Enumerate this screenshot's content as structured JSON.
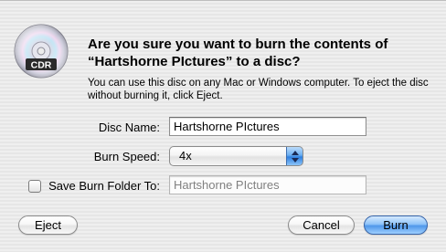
{
  "dialog": {
    "icon": "cdr-disc-icon",
    "icon_label": "CDR",
    "heading": "Are you sure you want to burn the contents of “Hartshorne PIctures” to a disc?",
    "message": "You can use this disc on any Mac or Windows computer. To eject the disc without burning it, click Eject."
  },
  "form": {
    "disc_name_label": "Disc Name:",
    "disc_name_value": "Hartshorne PIctures",
    "burn_speed_label": "Burn Speed:",
    "burn_speed_value": "4x",
    "save_folder_label": "Save Burn Folder To:",
    "save_folder_value": "Hartshorne PIctures",
    "save_folder_checked": false
  },
  "buttons": {
    "eject": "Eject",
    "cancel": "Cancel",
    "burn": "Burn"
  },
  "colors": {
    "accent": "#4e97ea",
    "sheet_background": "#ececec"
  }
}
